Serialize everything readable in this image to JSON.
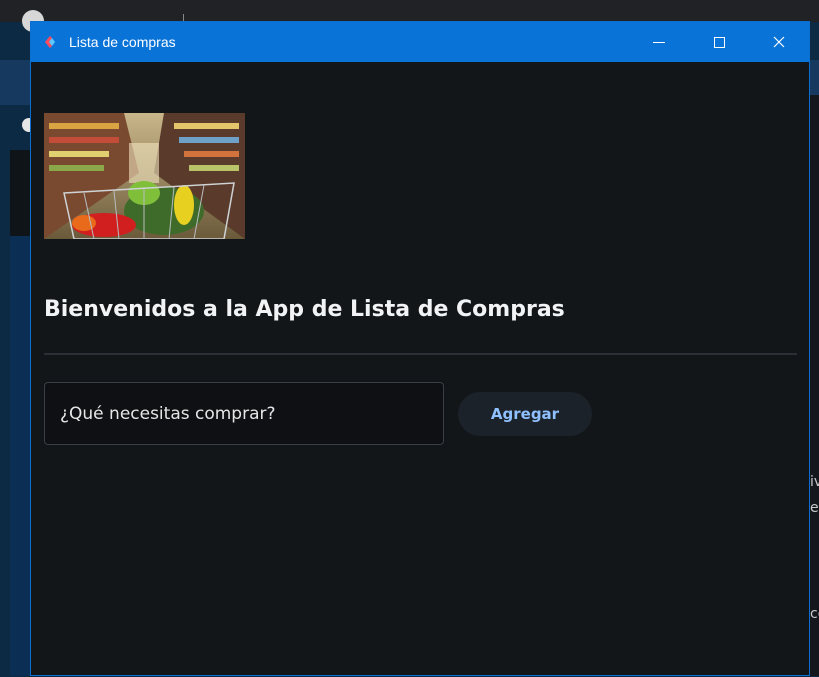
{
  "window": {
    "title": "Lista de compras",
    "icon": "app-icon",
    "controls": {
      "minimize": "minimize-icon",
      "maximize": "maximize-icon",
      "close": "close-icon"
    }
  },
  "main": {
    "heading": "Bienvenidos a la App de Lista de Compras",
    "input_placeholder": "¿Qué necesitas comprar?",
    "add_button": "Agregar"
  },
  "background": {
    "right_text": [
      "iv",
      "es",
      "co"
    ]
  },
  "colors": {
    "titlebar": "#0a73d8",
    "window_bg": "#131619",
    "button_text": "#8fc0ff",
    "heading_text": "#f1f3f5"
  }
}
